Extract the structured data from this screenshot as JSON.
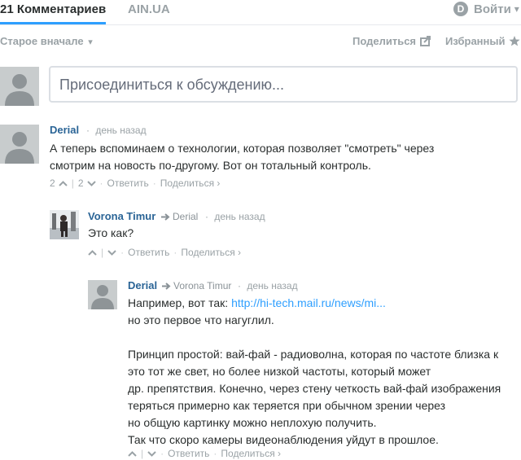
{
  "nav": {
    "comments_tab": "21 Комментариев",
    "site_tab": "AIN.UA",
    "login_label": "Войти",
    "login_caret": "▾"
  },
  "toolbar": {
    "sort_label": "Старое вначале",
    "sort_caret": "▾",
    "share_label": "Поделиться",
    "favorite_label": "Избранный"
  },
  "compose": {
    "placeholder": "Присоединиться к обсуждению..."
  },
  "comments": [
    {
      "author": "Derial",
      "reply_to": "",
      "time": "день назад",
      "lines": [
        "А теперь вспоминаем о технологии, которая позволяет \"смотреть\" через",
        "смотрим на новость по-другому. Вот он тотальный контроль."
      ],
      "upvotes": "2",
      "downvotes": "2",
      "reply_label": "Ответить",
      "share_label": "Поделиться ›"
    },
    {
      "author": "Vorona Timur",
      "reply_to": "Derial",
      "time": "день назад",
      "lines": [
        "Это как?"
      ],
      "upvotes": "",
      "downvotes": "",
      "reply_label": "Ответить",
      "share_label": "Поделиться ›"
    },
    {
      "author": "Derial",
      "reply_to": "Vorona Timur",
      "time": "день назад",
      "link_prefix": "Например, вот так: ",
      "link_text": "http://hi-tech.mail.ru/news/mi...",
      "lines": [
        "но это первое что нагуглил.",
        "Принцип простой: вай-фай - радиоволна, которая по частоте близка к",
        "это тот же свет, но более низкой частоты, который может",
        "др. препятствия. Конечно, через стену четкость вай-фай изображения",
        "теряться примерно как теряется при обычном зрении через",
        "но общую картинку можно неплохую получить.",
        "Так что скоро камеры видеонаблюдения уйдут в прошлое."
      ],
      "upvotes": "",
      "downvotes": "",
      "reply_label": "Ответить",
      "share_label": "Поделиться ›"
    }
  ],
  "colors": {
    "accent": "#2e9fff",
    "author": "#2a6496",
    "muted": "#9aa2a6"
  }
}
